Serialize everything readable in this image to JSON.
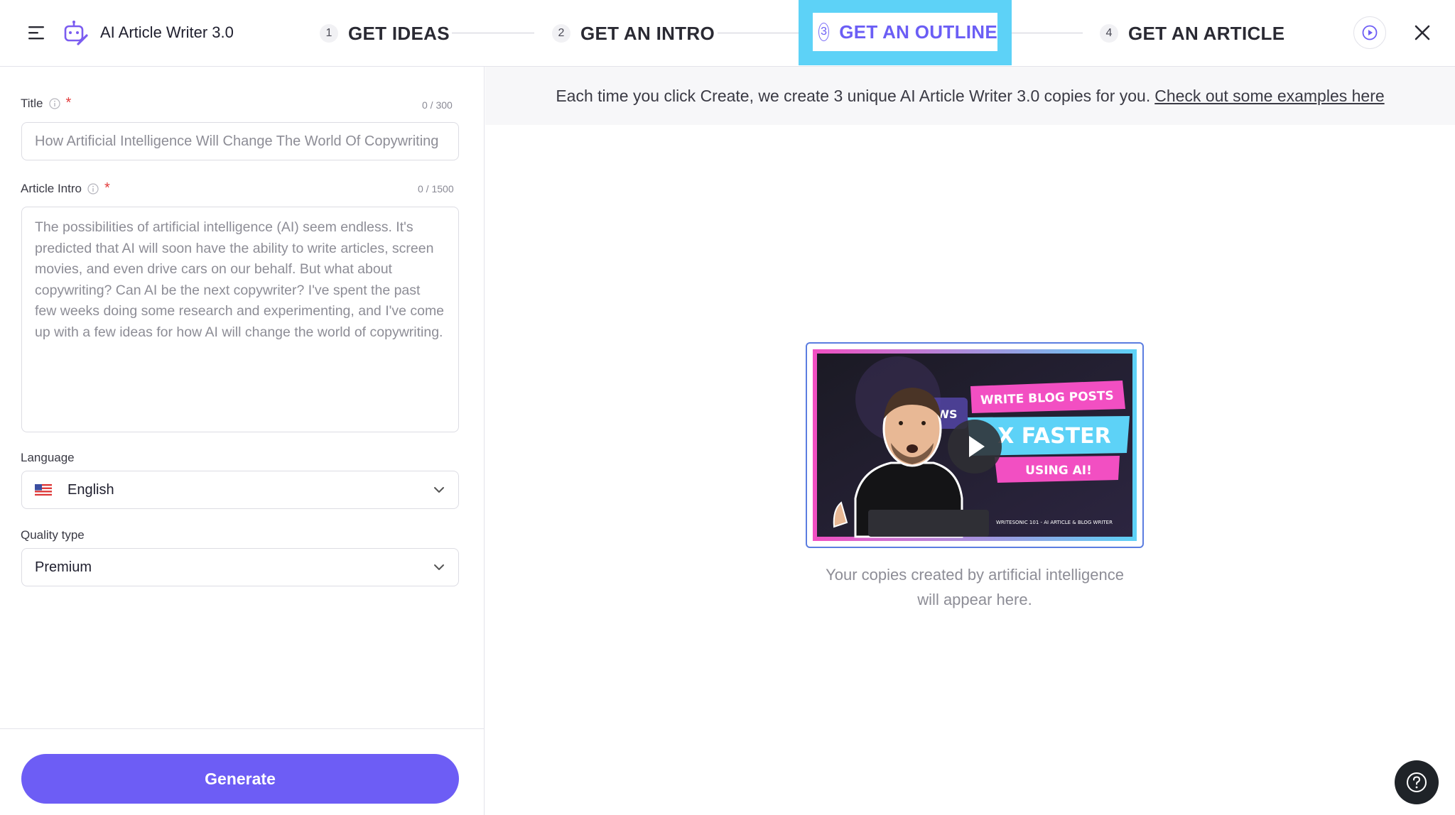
{
  "header": {
    "app_title": "AI Article Writer 3.0",
    "icons": {
      "menu": "hamburger-icon",
      "logo": "robot-pen-icon",
      "play": "play-circle-icon",
      "close": "close-icon"
    },
    "steps": [
      {
        "num": "1",
        "label": "GET IDEAS",
        "active": false
      },
      {
        "num": "2",
        "label": "GET AN INTRO",
        "active": false
      },
      {
        "num": "3",
        "label": "GET AN OUTLINE",
        "active": true
      },
      {
        "num": "4",
        "label": "GET AN ARTICLE",
        "active": false
      }
    ]
  },
  "form": {
    "title": {
      "label": "Title",
      "required_mark": "*",
      "counter": "0 / 300",
      "placeholder": "How Artificial Intelligence Will Change The World Of Copywriting"
    },
    "intro": {
      "label": "Article Intro",
      "required_mark": "*",
      "counter": "0 / 1500",
      "placeholder": "The possibilities of artificial intelligence (AI) seem endless. It's predicted that AI will soon have the ability to write articles, screen movies, and even drive cars on our behalf. But what about copywriting? Can AI be the next copywriter? I've spent the past few weeks doing some research and experimenting, and I've come up with a few ideas for how AI will change the world of copywriting."
    },
    "language": {
      "label": "Language",
      "value": "English",
      "flag": "us-flag-icon"
    },
    "quality": {
      "label": "Quality type",
      "value": "Premium"
    },
    "generate_label": "Generate"
  },
  "main": {
    "banner_text": "Each time you click Create, we create 3 unique AI Article Writer 3.0 copies for you.",
    "banner_link": "Check out some examples here",
    "video": {
      "line1": "WRITE BLOG POSTS",
      "line2": "X FASTER",
      "line3": "USING AI!",
      "logo": "WS",
      "caption": "WRITESONIC 101 - AI ARTICLE & BLOG WRITER"
    },
    "empty_line1": "Your copies created by artificial intelligence",
    "empty_line2": "will appear here."
  },
  "colors": {
    "accent": "#6d5df5",
    "highlight": "#5dd2f7",
    "magenta": "#f24fc2"
  }
}
